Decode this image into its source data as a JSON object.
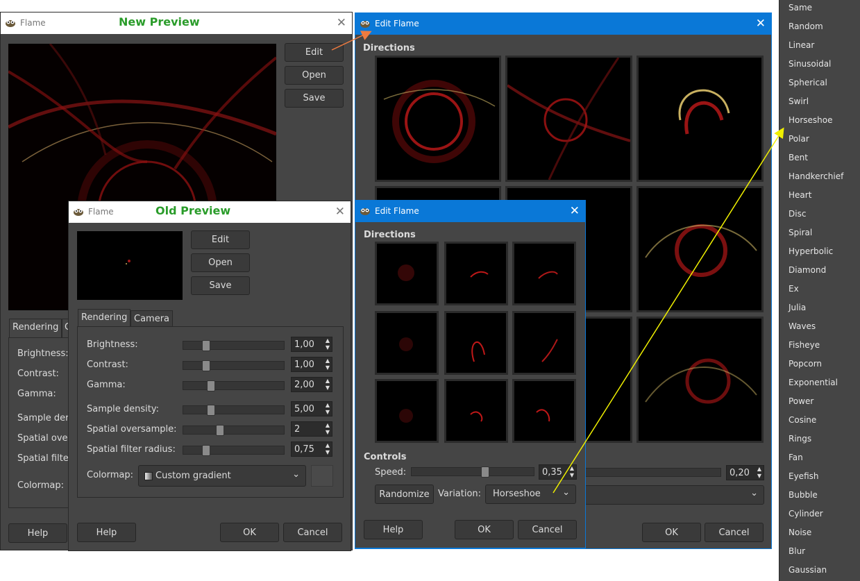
{
  "new_preview": {
    "window_title": "Flame",
    "annotation": "New Preview",
    "buttons": {
      "edit": "Edit",
      "open": "Open",
      "save": "Save"
    },
    "tabs": [
      "Rendering",
      "C"
    ],
    "rows": [
      "Brightness:",
      "Contrast:",
      "Gamma:",
      "Sample der",
      "Spatial ove",
      "Spatial filte",
      "Colormap:"
    ],
    "help": "Help"
  },
  "old_preview": {
    "window_title": "Flame",
    "annotation": "Old Preview",
    "buttons": {
      "edit": "Edit",
      "open": "Open",
      "save": "Save"
    },
    "tabs": [
      "Rendering",
      "Camera"
    ],
    "rows": [
      {
        "label": "Brightness:",
        "value": "1,00",
        "level": 0.2
      },
      {
        "label": "Contrast:",
        "value": "1,00",
        "level": 0.2
      },
      {
        "label": "Gamma:",
        "value": "2,00",
        "level": 0.25
      },
      {
        "label": "Sample density:",
        "value": "5,00",
        "level": 0.25
      },
      {
        "label": "Spatial oversample:",
        "value": "2",
        "level": 0.35
      },
      {
        "label": "Spatial filter radius:",
        "value": "0,75",
        "level": 0.2
      }
    ],
    "colormap_label": "Colormap:",
    "colormap_value": "Custom gradient",
    "help": "Help",
    "ok": "OK",
    "cancel": "Cancel"
  },
  "edit_large": {
    "window_title": "Edit Flame",
    "directions": "Directions",
    "speed_value": "0,20",
    "ok": "OK",
    "cancel": "Cancel"
  },
  "edit_small": {
    "window_title": "Edit Flame",
    "directions": "Directions",
    "controls": "Controls",
    "speed_label": "Speed:",
    "speed_value": "0,35",
    "speed_level": 0.6,
    "randomize": "Randomize",
    "variation_label": "Variation:",
    "variation_value": "Horseshoe",
    "help": "Help",
    "ok": "OK",
    "cancel": "Cancel"
  },
  "variation_menu": [
    "Same",
    "Random",
    "Linear",
    "Sinusoidal",
    "Spherical",
    "Swirl",
    "Horseshoe",
    "Polar",
    "Bent",
    "Handkerchief",
    "Heart",
    "Disc",
    "Spiral",
    "Hyperbolic",
    "Diamond",
    "Ex",
    "Julia",
    "Waves",
    "Fisheye",
    "Popcorn",
    "Exponential",
    "Power",
    "Cosine",
    "Rings",
    "Fan",
    "Eyefish",
    "Bubble",
    "Cylinder",
    "Noise",
    "Blur",
    "Gaussian"
  ],
  "colors": {
    "panel": "#454545",
    "accent_blue": "#0a78d7",
    "annotation_green": "#2a9c2a",
    "arrow_orange": "#f07b3f",
    "arrow_yellow": "#f0f000"
  }
}
